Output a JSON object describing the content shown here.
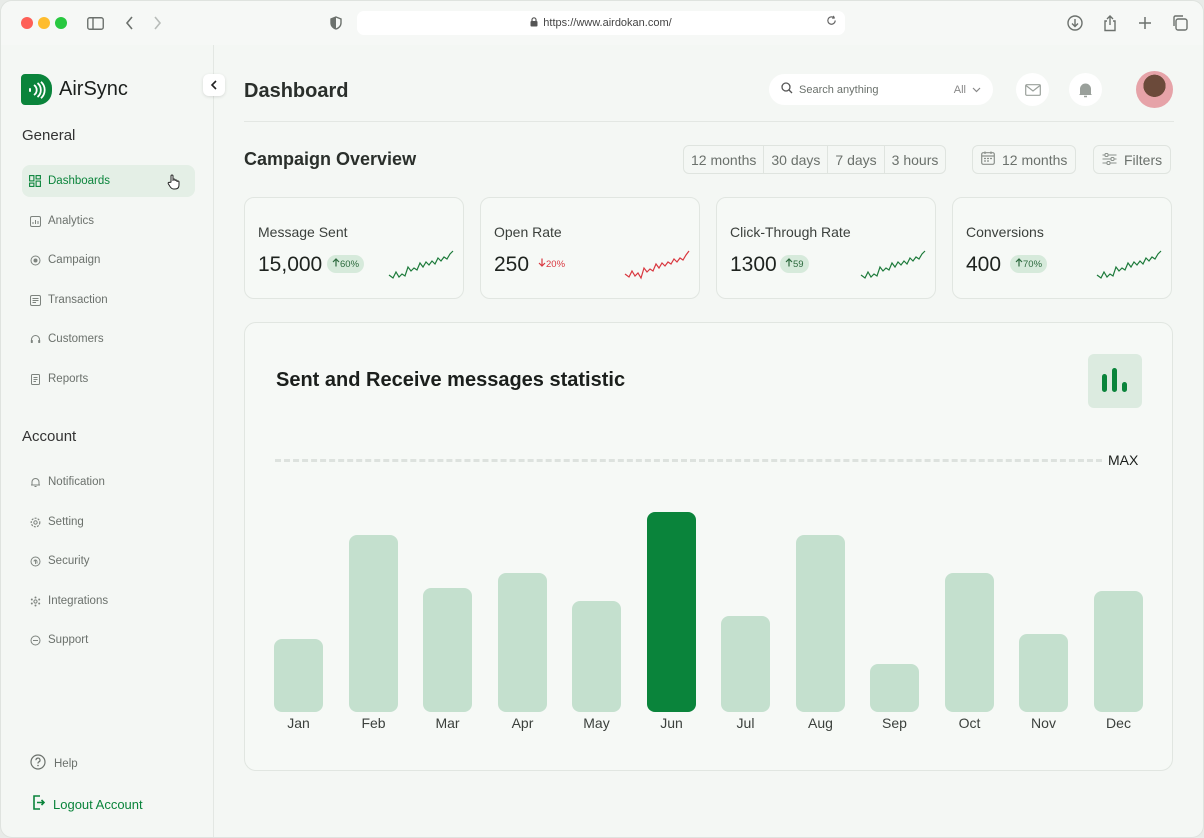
{
  "browser": {
    "url": "https://www.airdokan.com/"
  },
  "sidebar": {
    "brand": "AirSync",
    "general_title": "General",
    "general_items": [
      {
        "label": "Dashboards",
        "icon": "dashboard-icon",
        "active": true
      },
      {
        "label": "Analytics",
        "icon": "analytics-icon"
      },
      {
        "label": "Campaign",
        "icon": "campaign-icon"
      },
      {
        "label": "Transaction",
        "icon": "transaction-icon"
      },
      {
        "label": "Customers",
        "icon": "customers-icon"
      },
      {
        "label": "Reports",
        "icon": "reports-icon"
      }
    ],
    "account_title": "Account",
    "account_items": [
      {
        "label": "Notification",
        "icon": "bell-icon"
      },
      {
        "label": "Setting",
        "icon": "gear-icon"
      },
      {
        "label": "Security",
        "icon": "shield-icon"
      },
      {
        "label": "Integrations",
        "icon": "integrations-icon"
      },
      {
        "label": "Support",
        "icon": "support-icon"
      }
    ],
    "help_label": "Help",
    "logout_label": "Logout Account"
  },
  "header": {
    "title": "Dashboard",
    "search_placeholder": "Search anything",
    "search_scope": "All"
  },
  "overview": {
    "title": "Campaign Overview",
    "ranges": [
      "12 months",
      "30 days",
      "7 days",
      "3 hours"
    ],
    "date_picker_label": "12 months",
    "filters_label": "Filters"
  },
  "cards": [
    {
      "label": "Message Sent",
      "value": "15,000",
      "delta": "60%",
      "trend": "up"
    },
    {
      "label": "Open Rate",
      "value": "250",
      "delta": "20%",
      "trend": "down"
    },
    {
      "label": "Click-Through Rate",
      "value": "1300",
      "delta": "59",
      "trend": "up"
    },
    {
      "label": "Conversions",
      "value": "400",
      "delta": "70%",
      "trend": "up"
    }
  ],
  "chart": {
    "title": "Sent and Receive messages statistic",
    "max_label": "MAX"
  },
  "chart_data": {
    "type": "bar",
    "categories": [
      "Jan",
      "Feb",
      "Mar",
      "Apr",
      "May",
      "Jun",
      "Jul",
      "Aug",
      "Sep",
      "Oct",
      "Nov",
      "Dec"
    ],
    "values": [
      0.29,
      0.7,
      0.49,
      0.55,
      0.44,
      0.79,
      0.38,
      0.7,
      0.19,
      0.55,
      0.31,
      0.48
    ],
    "highlighted": "Jun",
    "max": 1.0,
    "colors": {
      "bar": "#c4e0ce",
      "highlight": "#0a843b"
    }
  },
  "colors": {
    "accent": "#0a843b",
    "down": "#d9373f"
  }
}
